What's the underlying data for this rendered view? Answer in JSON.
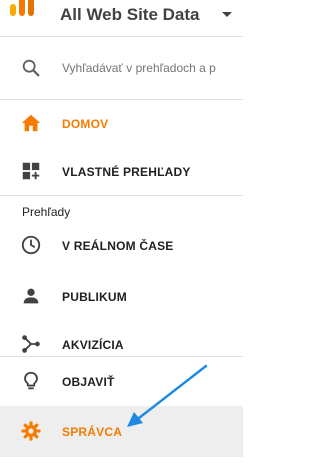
{
  "header": {
    "property_title": "All Web Site Data"
  },
  "search": {
    "placeholder": "Vyhľadávať v prehľadoch a p"
  },
  "nav": {
    "home": "DOMOV",
    "custom_reports": "VLASTNÉ PREHĽADY",
    "section_reports": "Prehľady",
    "realtime": "V REÁLNOM ČASE",
    "audience": "PUBLIKUM",
    "acquisition": "AKVIZÍCIA",
    "discover": "OBJAVIŤ",
    "admin": "SPRÁVCA"
  },
  "colors": {
    "accent": "#f57c00",
    "arrow": "#1e88e5",
    "text": "#212121",
    "muted": "#9e9e9e",
    "admin_bg": "#eeeeee"
  },
  "icons": {
    "logo": "analytics-logo-icon",
    "caret": "caret-down-icon",
    "search": "search-icon",
    "home": "home-icon",
    "custom_reports": "dashboard-add-icon",
    "realtime": "clock-icon",
    "audience": "person-icon",
    "acquisition": "share-icon",
    "discover": "lightbulb-icon",
    "admin": "gear-icon",
    "annotation": "pointer-arrow-icon"
  }
}
